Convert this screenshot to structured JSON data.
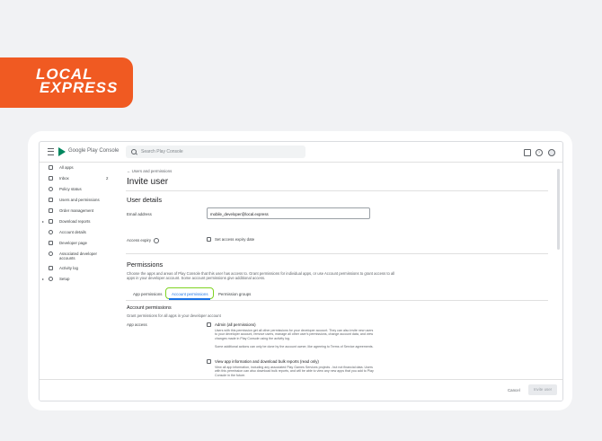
{
  "brand": {
    "line1": "LOCAL",
    "line2": "EXPRESS"
  },
  "topbar": {
    "app_name": "Google Play Console",
    "search_placeholder": "Search Play Console",
    "help_glyph": "?"
  },
  "sidebar": {
    "items": [
      {
        "label": "All apps",
        "icon": "grid-icon"
      },
      {
        "label": "Inbox",
        "icon": "inbox-icon",
        "count": "2"
      },
      {
        "label": "Policy status",
        "icon": "policy-icon"
      },
      {
        "label": "Users and permissions",
        "icon": "users-icon"
      },
      {
        "label": "Order management",
        "icon": "card-icon"
      },
      {
        "label": "Download reports",
        "icon": "download-icon",
        "expandable": true
      },
      {
        "label": "Account details",
        "icon": "account-icon"
      },
      {
        "label": "Developer page",
        "icon": "page-icon"
      },
      {
        "label": "Associated developer accounts",
        "icon": "link-icon"
      },
      {
        "label": "Activity log",
        "icon": "log-icon"
      },
      {
        "label": "Setup",
        "icon": "gear-icon",
        "expandable": true
      }
    ]
  },
  "main": {
    "breadcrumb": "← Users and permissions",
    "page_title": "Invite user",
    "user_details": {
      "title": "User details",
      "email_label": "Email address",
      "email_value": "mobile_developer@local.express",
      "access_expiry_label": "Access expiry",
      "access_expiry_checkbox": "Set access expiry date"
    },
    "permissions": {
      "title": "Permissions",
      "description": "Choose the apps and areas of Play Console that this user has access to. Grant permissions for individual apps, or use Account permissions to grant access to all apps in your developer account. Some account permissions give additional access.",
      "tabs": [
        "App permissions",
        "Account permissions",
        "Permission groups"
      ],
      "active_tab": 1
    },
    "account_permissions": {
      "title": "Account permissions",
      "description": "Grant permissions for all apps in your developer account",
      "app_access_label": "App access",
      "options": [
        {
          "title": "Admin (all permissions)",
          "description": "Users with this permission get all other permissions for your developer account. They can also invite new users to your developer account, remove users, manage all other user's permissions, change account data, and view changes made in Play Console using the activity log.",
          "extra": "Some additional actions can only be done by the account owner, like agreeing to Terms of Service agreements."
        },
        {
          "title": "View app information and download bulk reports (read only)",
          "description": "View all app information, including any associated Play Games Services projects - but not financial data. Users with this permission can also download bulk reports, and will be able to view any new apps that you add to Play Console in the future."
        }
      ]
    }
  },
  "footer": {
    "cancel_label": "Cancel",
    "invite_label": "Invite user"
  }
}
